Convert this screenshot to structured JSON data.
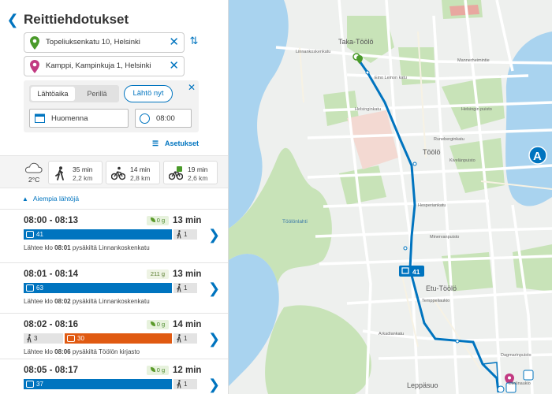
{
  "header": {
    "back_icon": "chevron-left-icon",
    "title": "Reittiehdotukset"
  },
  "from": {
    "value": "Topeliuksenkatu 10, Helsinki",
    "pin_color": "#4a9a2a"
  },
  "to": {
    "value": "Kamppi, Kampinkuja 1, Helsinki",
    "pin_color": "#c23a82"
  },
  "time": {
    "tabs": [
      "Lähtöaika",
      "Perillä"
    ],
    "now_button": "Lähtö nyt",
    "date": "Huomenna",
    "time": "08:00"
  },
  "settings_label": "Asetukset",
  "weather": {
    "temp": "2°C"
  },
  "modes": [
    {
      "icon": "walk-icon",
      "duration": "35 min",
      "distance": "2,2 km"
    },
    {
      "icon": "bike-icon",
      "duration": "14 min",
      "distance": "2,8 km"
    },
    {
      "icon": "citybike-icon",
      "duration": "19 min",
      "distance": "2,6 km"
    }
  ],
  "earlier_label": "Aiempia lähtöjä",
  "itineraries": [
    {
      "time": "08:00 - 08:13",
      "co2": "0 g",
      "duration": "13 min",
      "bus": "41",
      "walk_end": "1",
      "info_prefix": "Lähtee klo ",
      "info_time": "08:01",
      "info_suffix": " pysäkiltä Linnankoskenkatu"
    },
    {
      "time": "08:01 - 08:14",
      "co2": "211 g",
      "duration": "13 min",
      "bus": "63",
      "walk_end": "1",
      "info_prefix": "Lähtee klo ",
      "info_time": "08:02",
      "info_suffix": " pysäkiltä Linnankoskenkatu"
    },
    {
      "time": "08:02 - 08:16",
      "co2": "0 g",
      "duration": "14 min",
      "walk_start": "3",
      "tram": "30",
      "walk_end": "1",
      "info_prefix": "Lähtee klo ",
      "info_time": "08:06",
      "info_suffix": " pysäkiltä Töölön kirjasto"
    },
    {
      "time": "08:05 - 08:17",
      "co2": "0 g",
      "duration": "12 min",
      "bus": "37",
      "walk_end": "1"
    }
  ],
  "map": {
    "labels": {
      "taka_toolo": "Taka-Töölö",
      "toolo": "Töölö",
      "etu_toolo": "Etu-Töölö",
      "leppasuo": "Leppäsuo",
      "toolonlahti": "Töölönlahti",
      "linnankoskenkatu": "Linnankoskenkatu",
      "eino_leinon_katu": "Eino Leinon katu",
      "mannerheimintie": "Mannerheimintie",
      "helsinginkatu": "Helsinginkatu",
      "runeberginkatu": "Runeberginkatu",
      "hesperiankatu": "Hesperiankatu",
      "arkadiankatu": "Arkadiankatu",
      "kivelanpuisto": "Kivelänpuisto",
      "helsingin_puisto": "Helsingin puisto",
      "minervanpuisto": "Minervanpuisto",
      "temppeliaukio": "Temppeliaukio",
      "dagmarinpuisto": "Dagmarinpuisto",
      "elielinaukio": "Elielinaukio"
    },
    "route_color": "#0074bf",
    "bus_badge": "41",
    "poi_letter": "A"
  }
}
